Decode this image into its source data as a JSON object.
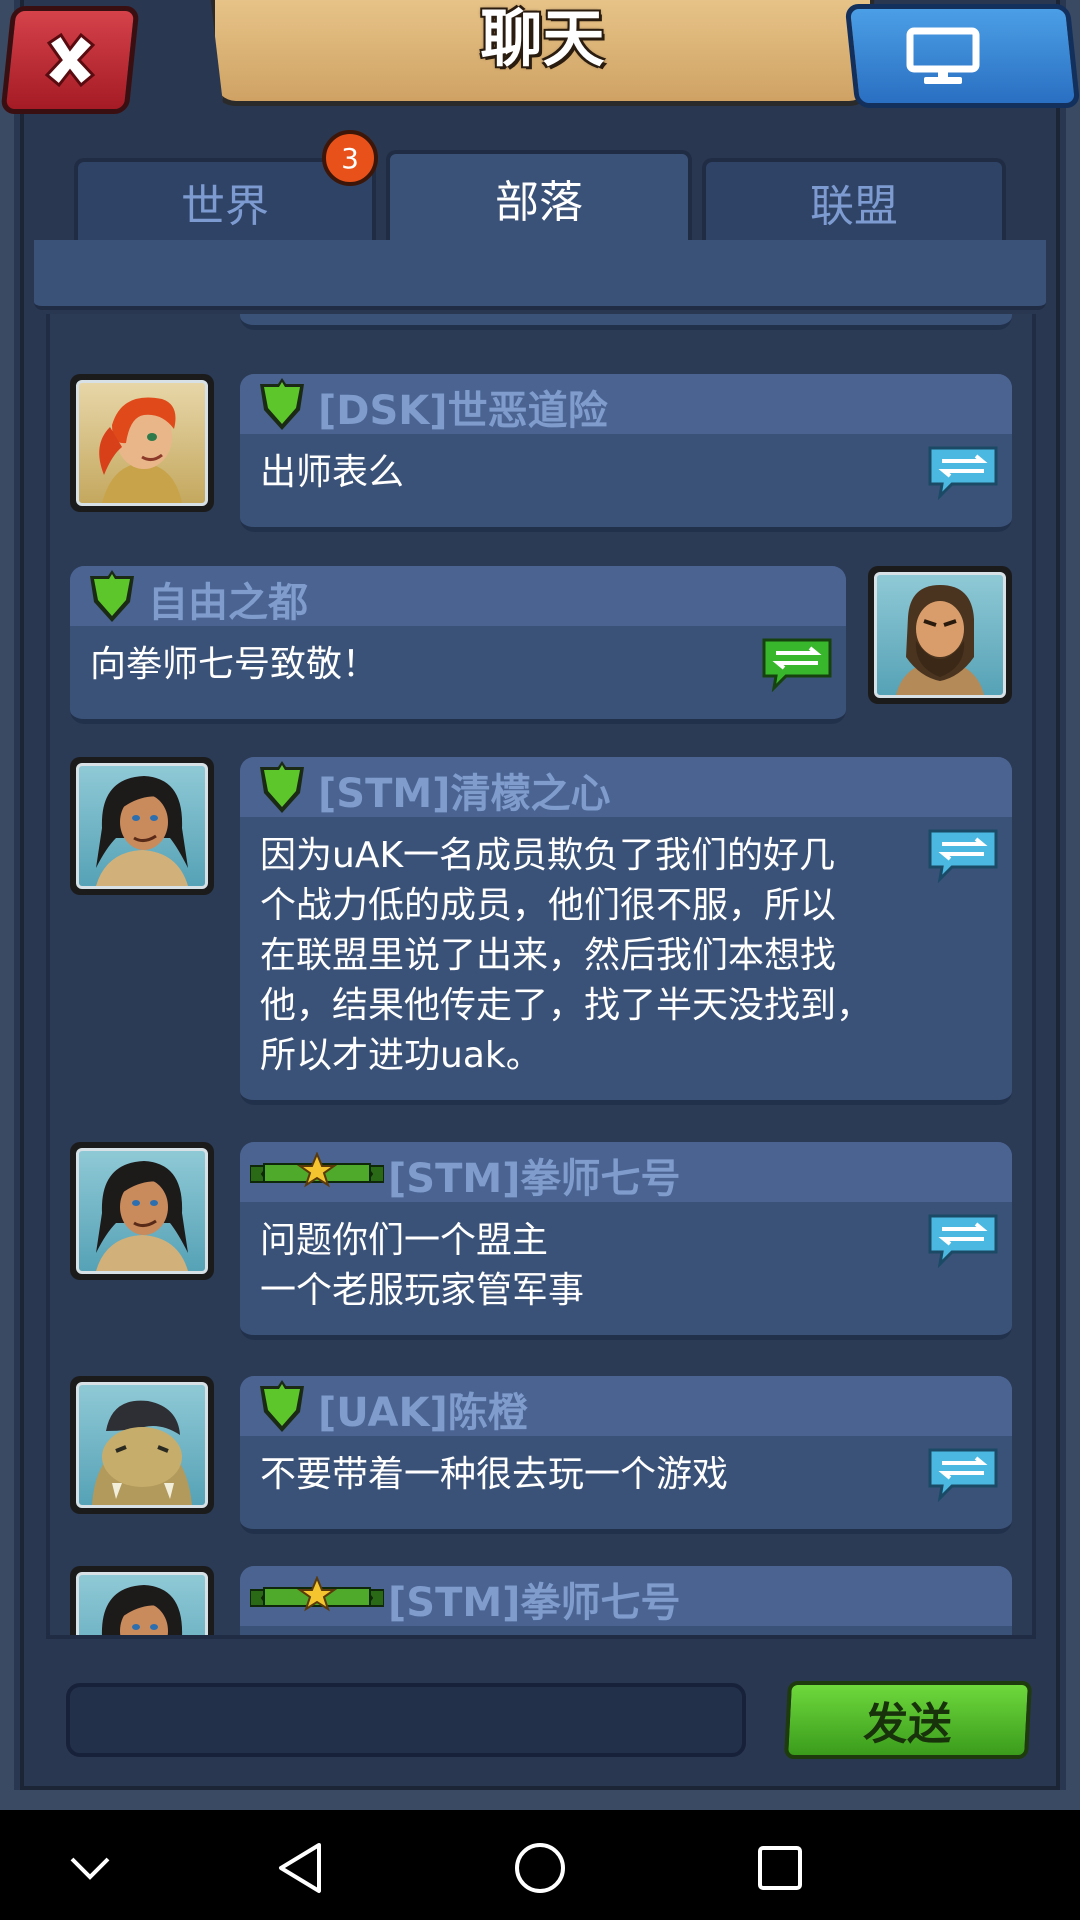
{
  "header": {
    "title": "聊天",
    "close_icon": "close-x-icon",
    "screen_icon": "monitor-icon"
  },
  "tabs": [
    {
      "label": "世界",
      "badge": "3",
      "active": false
    },
    {
      "label": "部落",
      "active": true
    },
    {
      "label": "联盟",
      "active": false
    }
  ],
  "messages": [
    {
      "sender": "[DSK]世恶道险",
      "text": "出师表么",
      "rank": "green-shield",
      "side": "left",
      "avatar": "red-haired-woman"
    },
    {
      "sender": "自由之都",
      "text": "向拳师七号致敬！",
      "rank": "green-shield",
      "side": "right",
      "avatar": "bearded-warrior"
    },
    {
      "sender": "[STM]清檬之心",
      "text_lines": [
        "因为uAK一名成员欺负了我们的好几",
        "个战力低的成员，他们很不服，所以",
        "在联盟里说了出来，然后我们本想找",
        "他，结果他传走了，找了半天没找到，",
        "所以才进功uak。"
      ],
      "rank": "green-shield",
      "side": "left",
      "avatar": "long-haired-warrior"
    },
    {
      "sender": "[STM]拳师七号",
      "text_lines": [
        "问题你们一个盟主",
        "一个老服玩家管军事"
      ],
      "rank": "star-ribbon",
      "side": "left",
      "avatar": "long-haired-warrior"
    },
    {
      "sender": "[UAK]陈橙",
      "text": "不要带着一种很去玩一个游戏",
      "rank": "green-shield",
      "side": "left",
      "avatar": "dinosaur"
    },
    {
      "sender": "[STM]拳师七号",
      "text": "",
      "rank": "star-ribbon",
      "side": "left",
      "avatar": "long-haired-warrior"
    }
  ],
  "input": {
    "value": "",
    "placeholder": ""
  },
  "send_button": "发送",
  "colors": {
    "frame": "#2a3750",
    "bubble": "#3b5278",
    "bubble_header": "#4a6391",
    "sender": "#7f9ccd",
    "send_green": "#4fb82a",
    "badge": "#e8511a",
    "close_red": "#c2303a",
    "screen_blue": "#3a86d6",
    "translate_blue": "#4ab8e0",
    "translate_green": "#39b72c"
  },
  "nav": {
    "icons": [
      "chevron-down-icon",
      "back-icon",
      "home-icon",
      "recents-icon"
    ]
  }
}
